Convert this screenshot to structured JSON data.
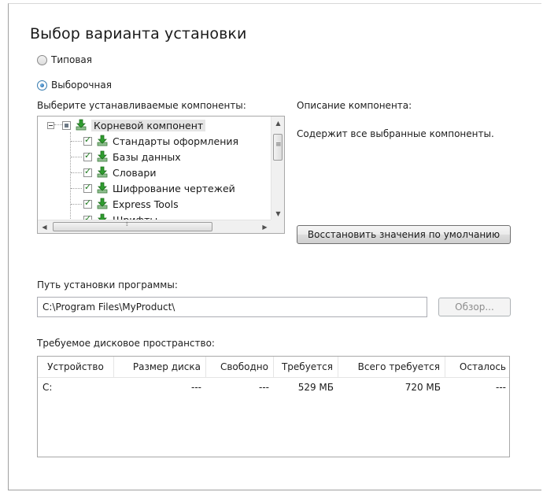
{
  "title": "Выбор варианта установки",
  "setup_types": [
    {
      "label": "Типовая",
      "checked": false
    },
    {
      "label": "Выборочная",
      "checked": true
    }
  ],
  "components_label": "Выберите устанавливаемые компоненты:",
  "components": [
    {
      "label": "Корневой компонент",
      "root": true,
      "state": "partial"
    },
    {
      "label": "Стандарты оформления",
      "state": "checked"
    },
    {
      "label": "Базы данных",
      "state": "checked"
    },
    {
      "label": "Словари",
      "state": "checked"
    },
    {
      "label": "Шифрование чертежей",
      "state": "checked"
    },
    {
      "label": "Express Tools",
      "state": "checked"
    },
    {
      "label": "Шрифты",
      "state": "checked"
    }
  ],
  "description_label": "Описание компонента:",
  "description_text": "Содержит все выбранные компоненты.",
  "restore_defaults_label": "Восстановить значения по умолчанию",
  "install_path_label": "Путь установки программы:",
  "install_path_value": "C:\\Program Files\\MyProduct\\",
  "browse_label": "Обзор...",
  "disk_space_label": "Требуемое дисковое пространство:",
  "disk_table": {
    "columns": [
      "Устройство",
      "Размер диска",
      "Свободно",
      "Требуется",
      "Всего требуется",
      "Осталось"
    ],
    "rows": [
      [
        "C:",
        "---",
        "---",
        "529 МБ",
        "720 МБ",
        "---"
      ]
    ]
  },
  "colors": {
    "radio_accent": "#1a5f9e",
    "check_green": "#1d7a1d",
    "icon_green": "#2f9d2f"
  }
}
